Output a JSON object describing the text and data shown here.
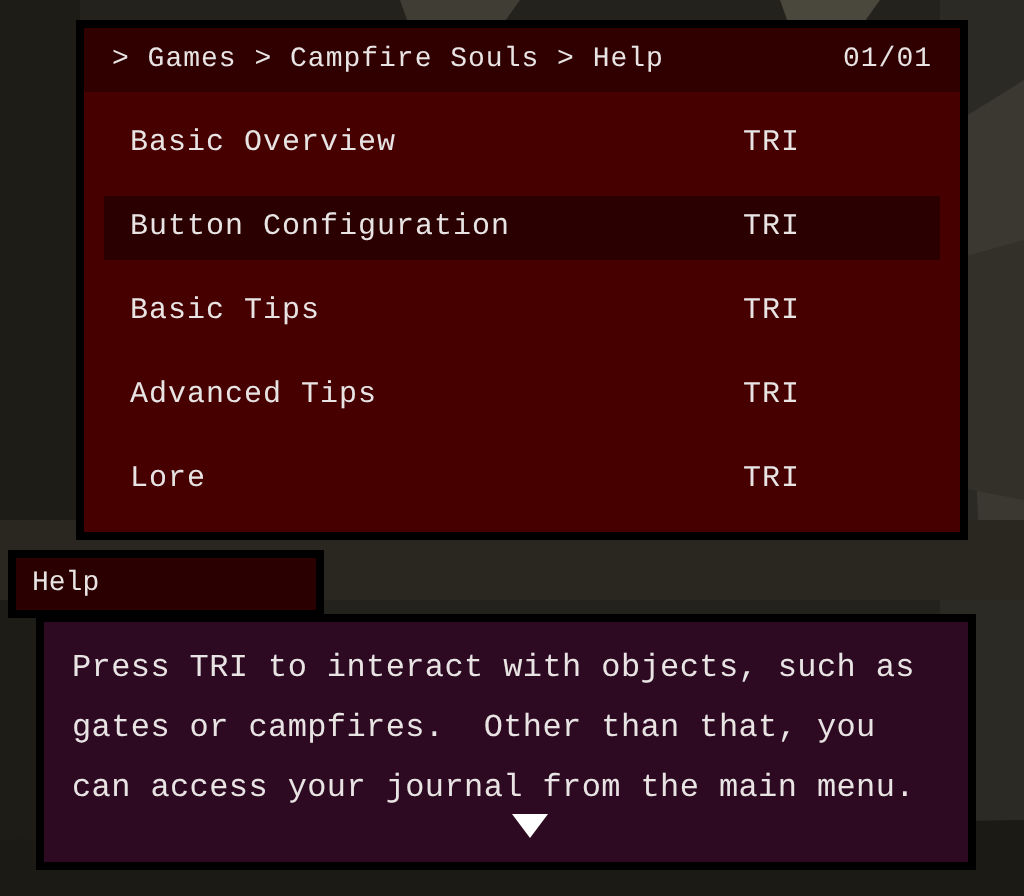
{
  "header": {
    "breadcrumb": "> Games > Campfire Souls > Help",
    "page": "01/01"
  },
  "items": [
    {
      "label": "Basic Overview",
      "button": "TRI",
      "selected": false
    },
    {
      "label": "Button Configuration",
      "button": "TRI",
      "selected": true
    },
    {
      "label": "Basic Tips",
      "button": "TRI",
      "selected": false
    },
    {
      "label": "Advanced Tips",
      "button": "TRI",
      "selected": false
    },
    {
      "label": "Lore",
      "button": "TRI",
      "selected": false
    }
  ],
  "help": {
    "title": "Help",
    "lines": [
      "Press TRI to interact with objects, such as",
      "gates or campfires.  Other than that, you",
      "can access your journal from the main menu."
    ],
    "more": true
  }
}
